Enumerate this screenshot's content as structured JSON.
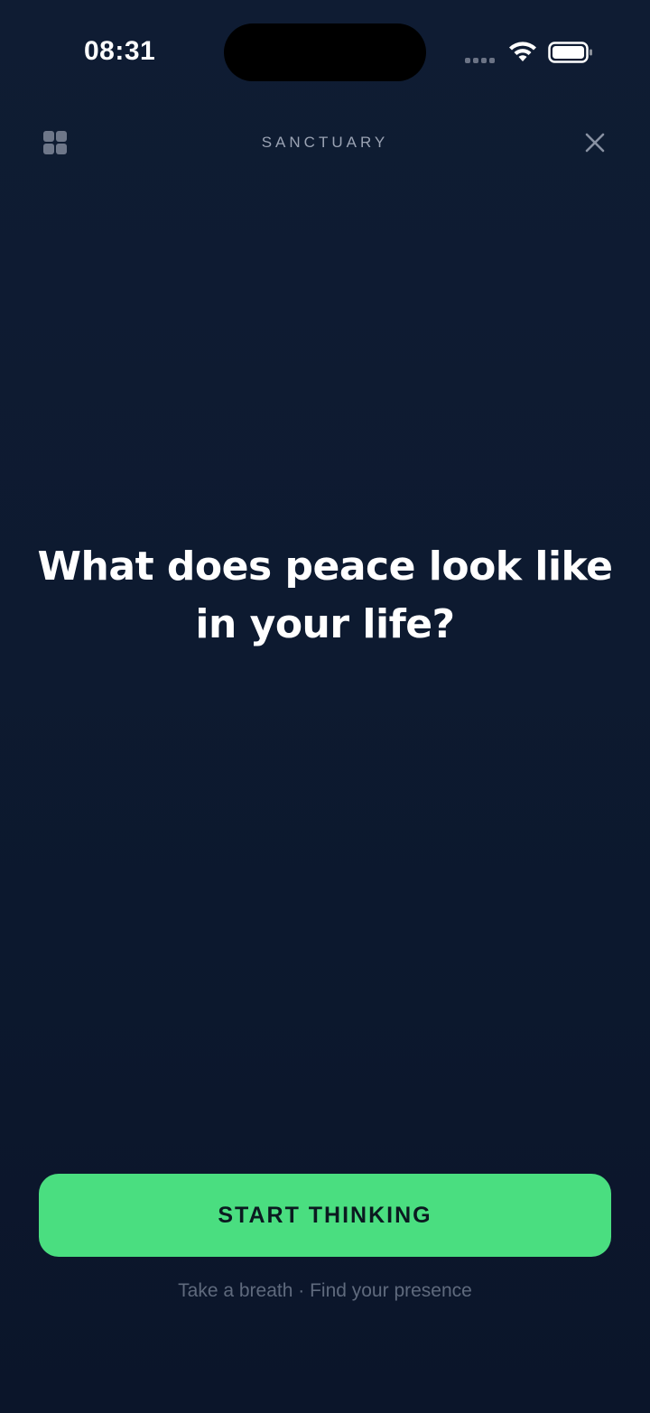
{
  "status_bar": {
    "time": "08:31",
    "signal_icon": "cellular-signal-icon",
    "wifi_icon": "wifi-icon",
    "battery_icon": "battery-icon"
  },
  "nav": {
    "menu_icon": "grid-icon",
    "title": "SANCTUARY",
    "close_icon": "close-icon"
  },
  "prompt": {
    "text": "What does peace look like in your life?"
  },
  "action": {
    "button_label": "START THINKING",
    "subtitle": "Take a breath · Find your presence"
  },
  "colors": {
    "background": "#0d1a30",
    "accent": "#4ade80",
    "muted_text": "#5f6a7d",
    "nav_text": "#9aa3b3"
  }
}
